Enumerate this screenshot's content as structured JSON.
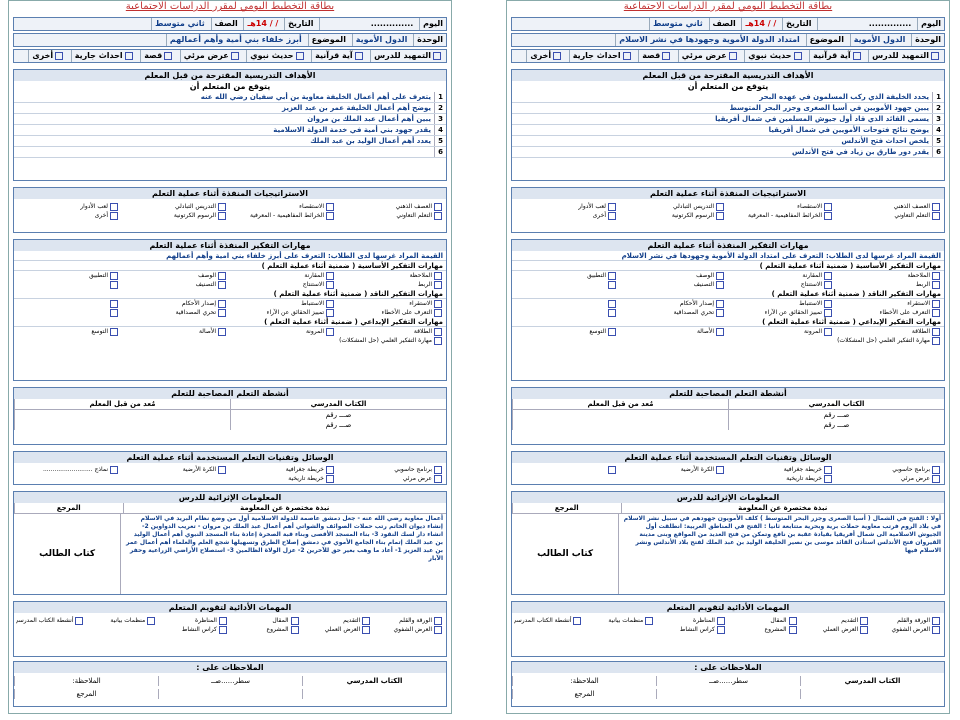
{
  "sheets": [
    {
      "title": "بطاقة التخطيط اليومي لمقرر الدراسات الاجتماعية",
      "header1": {
        "day": "اليوم",
        "date": "التاريخ",
        "date_val": "/ / 14هـ",
        "grade": "الصف",
        "grade_val": "ثاني متوسط"
      },
      "header2": {
        "unit": "الوحدة",
        "unit_val": "الدول الأموية",
        "topic": "الموضوع",
        "topic_val": "امتداد الدولة الأموية وجهودها في نشر الاسلام"
      },
      "header3": [
        "التمهيد للدرس",
        "آية قرآنية",
        "حديث نبوي",
        "عرض مرئي",
        "قصة",
        "احداث جارية",
        "أخرى"
      ],
      "objectives_title": "الأهداف التدريسية المقترحة من قبل المعلم",
      "objectives_sub": "يتوقع من المتعلم أن",
      "objectives": [
        {
          "n": "1",
          "t": "يحدد الخليفة الذي ركب المسلمون في عهده البحر"
        },
        {
          "n": "2",
          "t": "يبين جهود الأمويين في أسيا الصغرى وجزر البحر المتوسط"
        },
        {
          "n": "3",
          "t": "يسمي القائد الذي قاد أول جيوش المسلمين في شمال أفريقيا"
        },
        {
          "n": "4",
          "t": "يوضح نتائج فتوحات الأمويين في شمال أفريقيا"
        },
        {
          "n": "5",
          "t": "يلخص احداث فتح الأندلس"
        },
        {
          "n": "6",
          "t": "يقدر دور طارق بن زياد في فتح الأندلس"
        }
      ],
      "strategies_title": "الاستراتيجيات المنفذة أثناء عملية التعلم",
      "strategies": [
        "العصف الذهني",
        "الاستقصاء",
        "التدريس التبادلي",
        "لعب الأدوار",
        "التعلم التعاوني",
        "الخرائط المفاهيمية - المعرفية",
        "الرسوم الكرتونية",
        "أخرى"
      ],
      "thinking_title": "مهارات التفكير المنفذة أثناء عملية التعلم",
      "value": "القيمة المراد غرسها لدى الطلاب: التعرف على امتداد الدولة الأموية وجهودها في نشر الاسلام",
      "basic_title": "مهارات التفكير الأساسية ( ضمنية أثناء عملية التعلم )",
      "basic": [
        "الملاحظة",
        "المقارنة",
        "الوصف",
        "التطبيق",
        "الربط",
        "الاستنتاج",
        "التصنيف",
        ""
      ],
      "critical_title": "مهارات التفكير الناقد ( ضمنية أثناء عملية التعلم )",
      "critical": [
        "الاستقراء",
        "الاستنباط",
        "إصدار الأحكام",
        "",
        "التعرف على الأخطاء",
        "تمييز الحقائق عن الآراء",
        "تحري المصداقية",
        ""
      ],
      "creative_title": "مهارات التفكير الإبداعي ( ضمنية أثناء عملية التعلم )",
      "creative": [
        "الطلاقة",
        "المرونة",
        "الأصالة",
        "التوسع",
        "مهارة التفكير العلمي (حل المشكلات)",
        "",
        "",
        ""
      ],
      "activities_title": "أنشطة التعلم المصاحبة للتعلم",
      "activities_cols": [
        "الكتاب المدرسي",
        "مُعد من قبل المعلم"
      ],
      "activities_rows": [
        "صـــ رقم",
        "صـــ رقم"
      ],
      "media_title": "الوسائل وتقنيات التعلم المستخدمة أثناء عملية التعلم",
      "media": [
        "برنامج حاسوبي",
        "خريطة جغرافية",
        "الكرة الأرضية",
        "",
        "عرض مرئي",
        "خريطة تاريخية",
        "",
        ""
      ],
      "info_title": "المعلومات الإثرائية للدرس",
      "info_cols": [
        "نبذة مختصرة عن المعلومة",
        "المرجع"
      ],
      "info_text": "أولا : الفتح في الشمال ( أسيا الصغرى وجزر البحر المتوسط ) كلف الأمويون جهودهم في سبيل نشر الاسلام في بلاد الروم فرتب معاوية حملات برية وبحرية متتابعة ثانيا : الفتح في المناطق الغربية: انطلقت أول الجيوش الاسلامية الى شمال أفريقيا بقيادة عقبة بن نافع وتمكن من فتح العديد من المواقع وبنى مدينة القيروان فتح الأندلس استأذن القائد موسى بن نصير الخليفة الوليد بن عبد الملك لفتح بلاد الأندلس ونشر الاسلام فيها",
      "info_ref": "كتاب الطالب",
      "tasks_title": "المهمات الأدائية لتقويم المتعلم",
      "tasks": [
        "الورقة والقلم",
        "التقديم",
        "المقال",
        "المناظرة",
        "منظمات بيانية",
        "أنشطة الكتاب المدرسي",
        "العرض الشفوي",
        "العرض العملي",
        "المشروع",
        "كراس النشاط"
      ],
      "notes_title": "الملاحظات على :",
      "notes": [
        "الكتاب المدرسي",
        "سطر......صــ",
        "الملاحظة:",
        "المرجع"
      ]
    },
    {
      "title": "بطاقة التخطيط اليومي لمقرر الدراسات الاجتماعية",
      "header1": {
        "day": "اليوم",
        "date": "التاريخ",
        "date_val": "/ / 14هـ",
        "grade": "الصف",
        "grade_val": "ثاني متوسط"
      },
      "header2": {
        "unit": "الوحدة",
        "unit_val": "الدول الأموية",
        "topic": "الموضوع",
        "topic_val": "أبرز خلفاء بني أمية وأهم أعمالهم"
      },
      "header3": [
        "التمهيد للدرس",
        "آية قرآنية",
        "حديث نبوي",
        "عرض مرئي",
        "قصة",
        "احداث جارية",
        "أخرى"
      ],
      "objectives_title": "الأهداف التدريسية المقترحة من قبل المعلم",
      "objectives_sub": "يتوقع من المتعلم أن",
      "objectives": [
        {
          "n": "1",
          "t": "يتعرف على أهم أعمال الخليفة معاوية بن أبي سفيان رضي الله عنه"
        },
        {
          "n": "2",
          "t": "يوضح أهم أعمال الخليفة عمر بن عبد العزيز"
        },
        {
          "n": "3",
          "t": "يبين أهم أعمال عبد الملك بن مروان"
        },
        {
          "n": "4",
          "t": "يقدر جهود بني أمية في خدمة الدولة الاسلامية"
        },
        {
          "n": "5",
          "t": "يعدد أهم أعمال الوليد بن عبد الملك"
        },
        {
          "n": "6",
          "t": ""
        }
      ],
      "strategies_title": "الاستراتيجيات المنفذة أثناء عملية التعلم",
      "strategies": [
        "العصف الذهني",
        "الاستقصاء",
        "التدريس التبادلي",
        "لعب الأدوار",
        "التعلم التعاوني",
        "الخرائط المفاهيمية - المعرفية",
        "الرسوم الكرتونية",
        "أخرى"
      ],
      "thinking_title": "مهارات التفكير المنفذة أثناء عملية التعلم",
      "value": "القيمة المراد غرسها لدى الطلاب: التعرف على أبرز خلفاء بني امية وأهم أعمالهم",
      "basic_title": "مهارات التفكير الأساسية ( ضمنية أثناء عملية التعلم )",
      "basic": [
        "الملاحظة",
        "المقارنة",
        "الوصف",
        "التطبيق",
        "الربط",
        "الاستنتاج",
        "التصنيف",
        ""
      ],
      "critical_title": "مهارات التفكير الناقد ( ضمنية أثناء عملية التعلم )",
      "critical": [
        "الاستقراء",
        "الاستنباط",
        "إصدار الأحكام",
        "",
        "التعرف على الأخطاء",
        "تمييز الحقائق عن الآراء",
        "تحري المصداقية",
        ""
      ],
      "creative_title": "مهارات التفكير الإبداعي ( ضمنية أثناء عملية التعلم )",
      "creative": [
        "الطلاقة",
        "المرونة",
        "الأصالة",
        "التوسع",
        "مهارة التفكير العلمي (حل المشكلات)",
        "",
        "",
        ""
      ],
      "activities_title": "أنشطة التعلم المصاحبة للتعلم",
      "activities_cols": [
        "الكتاب المدرسي",
        "مُعد من قبل المعلم"
      ],
      "activities_rows": [
        "صـــ رقم",
        "صـــ رقم"
      ],
      "media_title": "الوسائل وتقنيات التعلم المستخدمة أثناء عملية التعلم",
      "media": [
        "برنامج حاسوبي",
        "خريطة جغرافية",
        "الكرة الأرضية",
        "نماذج ..........................",
        "عرض مرئي",
        "خريطة تاريخية",
        "",
        ""
      ],
      "info_title": "المعلومات الإثرائية للدرس",
      "info_cols": [
        "نبذة مختصرة عن المعلومة",
        "المرجع"
      ],
      "info_text": "أعمال معاوية رضي الله عنه - جعل دمشق عاصمة للدولة الاسلامية أول من وضع نظام البريد في الاسلام إنشاء ديوان الخاتم رتب حملات الصوائف والشواتي أهم أعمال عبد الملك بن مروان - تعريب الدواوين 2- انشاء دار لسك النقود 3- بناء المسجد الأقصى وبناء قبة الصخرة إعادة بناء المسجد النبوي أهم أعمال الوليد بن عبد الملك إتمام بناء الجامع الأموي في دمشق إصلاح الطرق وتسهيلها شجع العلم والعلماء أهم أعمال عمر بن عبد العزيز 1- أعاد ما وهب بغير حق للآخرين 2- عزل الولاة الظالمين 3- استصلاح الأراضي الزراعية وحفر الآبار",
      "info_ref": "كتاب الطالب",
      "tasks_title": "المهمات الأدائية لتقويم المتعلم",
      "tasks": [
        "الورقة والقلم",
        "التقديم",
        "المقال",
        "المناظرة",
        "منظمات بيانية",
        "أنشطة الكتاب المدرسي",
        "العرض الشفوي",
        "العرض العملي",
        "المشروع",
        "كراس النشاط"
      ],
      "notes_title": "الملاحظات على :",
      "notes": [
        "الكتاب المدرسي",
        "سطر......صــ",
        "الملاحظة:",
        "المرجع"
      ]
    }
  ]
}
